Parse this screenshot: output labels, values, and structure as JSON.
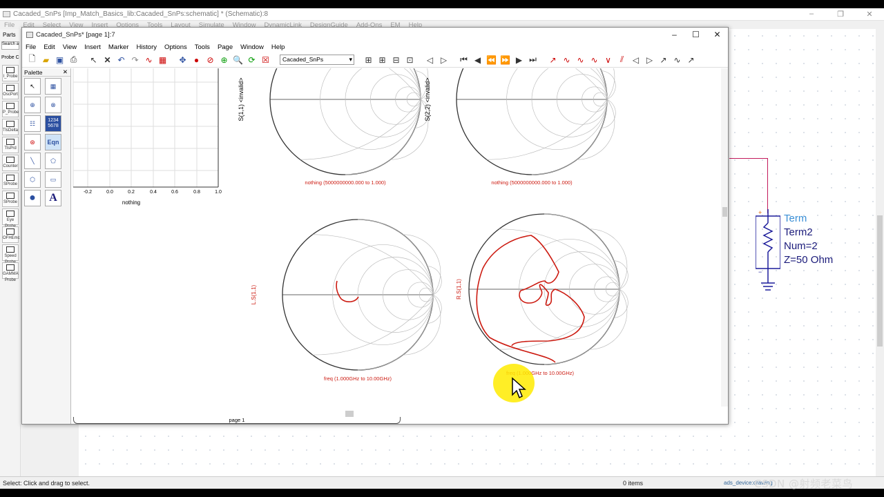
{
  "bg_app": {
    "title": "Cacaded_SnPs [Imp_Match_Basics_lib:Cacaded_SnPs:schematic] * (Schematic):8",
    "menu": [
      "File",
      "Edit",
      "Select",
      "View",
      "Insert",
      "Options",
      "Tools",
      "Layout",
      "Simulate",
      "Window",
      "DynamicLink",
      "DesignGuide",
      "Add-Ons",
      "EM",
      "Help"
    ],
    "left_tools": [
      "Parts",
      "Search a",
      "Probe C",
      "I_Probe",
      "OscPort",
      "P_Probe",
      "TlsDelta",
      "TlsPrd",
      "Counter",
      "SProbe",
      "SProbe",
      "Eye Probe",
      "OFHEmc",
      "Speed Probe",
      "GAMMA Probe"
    ],
    "status": "Select: Click and drag to select.",
    "items": "0 items",
    "status_right": "ads_device:drawing",
    "watermark": "CSDN @射频老菜鸟",
    "term": {
      "title": "Term",
      "name": "Term2",
      "num": "Num=2",
      "z": "Z=50 Ohm"
    }
  },
  "window": {
    "title": "Cacaded_SnPs* [page 1]:7",
    "menu": [
      "File",
      "Edit",
      "View",
      "Insert",
      "Marker",
      "History",
      "Options",
      "Tools",
      "Page",
      "Window",
      "Help"
    ],
    "combo_value": "Cacaded_SnPs",
    "palette_title": "Palette",
    "page_tab": "page 1"
  },
  "plots": {
    "rect_xticks": [
      "-0.2",
      "0.0",
      "0.2",
      "0.4",
      "0.6",
      "0.8",
      "1.0"
    ],
    "rect_xlabel": "nothing",
    "smith1_ylabel": "S(1,1) <invalid>",
    "smith1_caption": "nothing (5000000000.000 to 1.000)",
    "smith2_ylabel": "S(2,2) <invalid>",
    "smith2_caption": "nothing (5000000000.000 to 1.000)",
    "smith3_ylabel": "L.S(1,1)",
    "smith3_caption": "freq (1.000GHz to 10.00GHz)",
    "smith4_ylabel": "R.S(1,1)",
    "smith4_caption": "freq (1.000GHz to 10.00GHz)",
    "trace_color": "#cc1a10"
  }
}
